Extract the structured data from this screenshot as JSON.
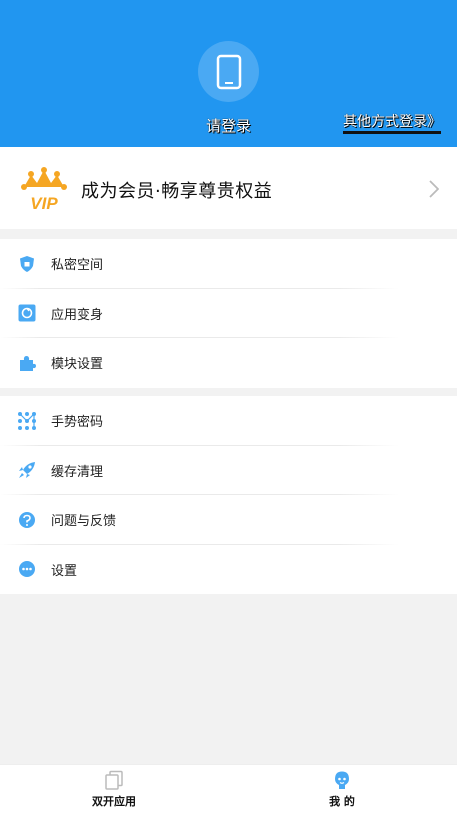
{
  "header": {
    "login_label": "请登录",
    "other_login": "其他方式登录》",
    "avatar_icon": "phone-icon",
    "background": "#2196f0"
  },
  "vip": {
    "badge_text": "VIP",
    "text": "成为会员·畅享尊贵权益",
    "icon": "vip-crown-icon"
  },
  "group1": [
    {
      "label": "私密空间",
      "icon": "shield-icon"
    },
    {
      "label": "应用变身",
      "icon": "app-disguise-icon"
    },
    {
      "label": "模块设置",
      "icon": "puzzle-icon"
    }
  ],
  "group2": [
    {
      "label": "手势密码",
      "icon": "gesture-pattern-icon"
    },
    {
      "label": "缓存清理",
      "icon": "rocket-icon"
    },
    {
      "label": "问题与反馈",
      "icon": "feedback-icon"
    },
    {
      "label": "设置",
      "icon": "settings-icon"
    }
  ],
  "tabs": [
    {
      "label": "双开应用",
      "icon": "dual-apps-icon"
    },
    {
      "label": "我 的",
      "icon": "profile-icon"
    }
  ],
  "colors": {
    "accent": "#2196f0",
    "vip_gold": "#f5a623",
    "icon_blue": "#4aa9f3"
  }
}
